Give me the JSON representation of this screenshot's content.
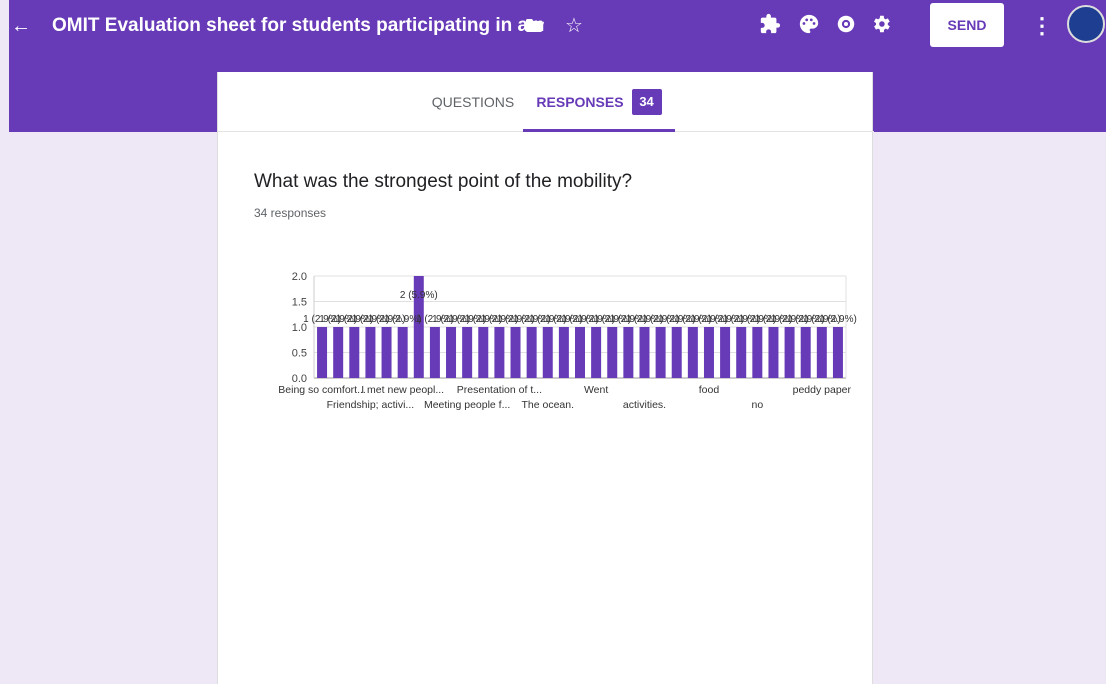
{
  "topbar": {
    "back_icon": "←",
    "title": "OMIT Evaluation sheet for students participating in a mobility",
    "star_icon": "☆",
    "send_label": "SEND",
    "more_icon": "⋮",
    "bg_color": "#673ab7"
  },
  "tabs": {
    "questions_label": "QUESTIONS",
    "responses_label": "RESPONSES",
    "responses_count": "34"
  },
  "question": {
    "title": "What was the strongest point of the mobility?",
    "responses": "34 responses"
  },
  "chart_data": {
    "type": "bar",
    "ylim": [
      0,
      2.0
    ],
    "yticks": [
      "0.0",
      "0.5",
      "1.0",
      "1.5",
      "2.0"
    ],
    "grid": true,
    "bar_color": "#673ab7",
    "values": [
      1,
      1,
      1,
      1,
      1,
      1,
      2,
      1,
      1,
      1,
      1,
      1,
      1,
      1,
      1,
      1,
      1,
      1,
      1,
      1,
      1,
      1,
      1,
      1,
      1,
      1,
      1,
      1,
      1,
      1,
      1,
      1,
      1
    ],
    "bar_labels": [
      "1 (2.9%)",
      "1 (2.9%)",
      "1 (2.9%)",
      "1 (2.9%)",
      "1 (2.9%)",
      "1 (2.9%)",
      "2 (5.9%)",
      "1 (2.9%)",
      "1 (2.9%)",
      "1 (2.9%)",
      "1 (2.9%)",
      "1 (2.9%)",
      "1 (2.9%)",
      "1 (2.9%)",
      "1 (2.9%)",
      "1 (2.9%)",
      "1 (2.9%)",
      "1 (2.9%)",
      "1 (2.9%)",
      "1 (2.9%)",
      "1 (2.9%)",
      "1 (2.9%)",
      "1 (2.9%)",
      "1 (2.9%)",
      "1 (2.9%)",
      "1 (2.9%)",
      "1 (2.9%)",
      "1 (2.9%)",
      "1 (2.9%)",
      "1 (2.9%)",
      "1 (2.9%)",
      "1 (2.9%)",
      "1 (2.9%)"
    ],
    "category_labels": [
      {
        "index": 0,
        "text": "Being so comfort...",
        "row": 1
      },
      {
        "index": 3,
        "text": "Friendship; activi...",
        "row": 2
      },
      {
        "index": 5,
        "text": "I met new peopl...",
        "row": 1
      },
      {
        "index": 9,
        "text": "Meeting people f...",
        "row": 2
      },
      {
        "index": 11,
        "text": "Presentation of t...",
        "row": 1
      },
      {
        "index": 14,
        "text": "The ocean.",
        "row": 2
      },
      {
        "index": 17,
        "text": "Went",
        "row": 1
      },
      {
        "index": 20,
        "text": "activities.",
        "row": 2
      },
      {
        "index": 24,
        "text": "food",
        "row": 1
      },
      {
        "index": 27,
        "text": "no",
        "row": 2
      },
      {
        "index": 31,
        "text": "peddy paper",
        "row": 1
      }
    ]
  }
}
